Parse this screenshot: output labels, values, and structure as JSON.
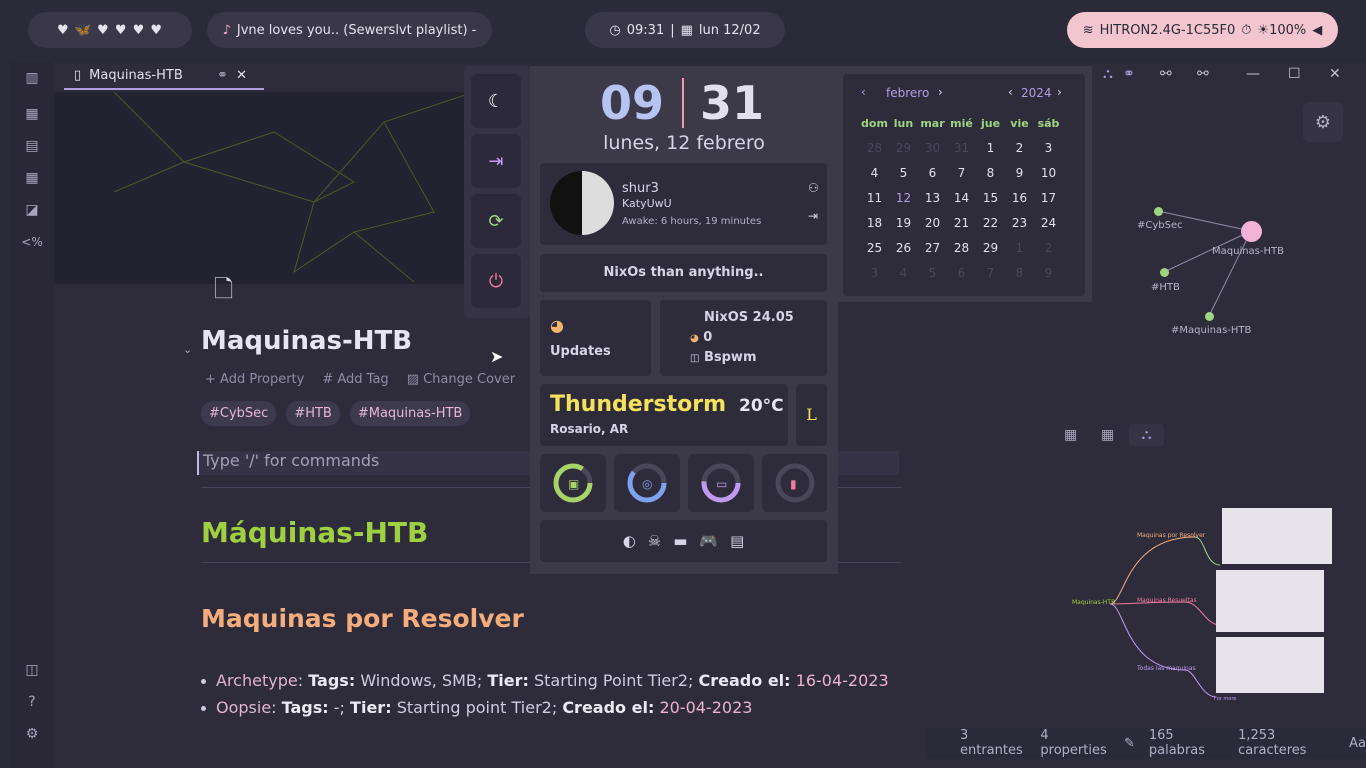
{
  "topbar": {
    "hearts": "♥ 🦋 ♥ ♥ ♥ ♥",
    "music_title": "Jvne loves you.. (Sewerslvt playlist) -",
    "time": "09:31",
    "date": "lun 12/02",
    "network": "HITRON2.4G-1C55F0",
    "brightness": "☀100%"
  },
  "tab": {
    "title": "Maquinas-HTB"
  },
  "page": {
    "title": "Maquinas-HTB",
    "add_property": "Add Property",
    "add_tag": "Add Tag",
    "change_cover": "Change Cover",
    "tags": [
      "#CybSec",
      "#HTB",
      "#Maquinas-HTB"
    ],
    "command_placeholder": "Type '/' for commands",
    "h1": "Máquinas-HTB",
    "h2": "Maquinas  por Resolver",
    "items": [
      {
        "link": "Archetype",
        "tags_label": "Tags:",
        "tags": "Windows, SMB;",
        "tier_label": "Tier:",
        "tier": "Starting Point Tier2;",
        "created_label": "Creado el:",
        "created": "16-04-2023"
      },
      {
        "link": "Oopsie",
        "tags_label": "Tags:",
        "tags": "-;",
        "tier_label": "Tier:",
        "tier": "Starting point Tier2;",
        "created_label": "Creado el:",
        "created": "20-04-2023"
      }
    ]
  },
  "dashboard": {
    "hour": "09",
    "minute": "31",
    "date_long": "lunes, 12 febrero",
    "user": "shur3",
    "host": "KatyUwU",
    "uptime": "Awake: 6 hours, 19 minutes",
    "motto": "NixOs than anything..",
    "updates_label": "Updates",
    "os": "NixOS 24.05",
    "updates_count": "0",
    "wm": "Bspwm",
    "weather": "Thunderstorm",
    "temp": "20°C",
    "city": "Rosario, AR",
    "weather_icon": "L"
  },
  "calendar": {
    "month": "febrero",
    "year": "2024",
    "weekdays": [
      "dom",
      "lun",
      "mar",
      "mié",
      "jue",
      "vie",
      "sáb"
    ],
    "days": [
      "28",
      "29",
      "30",
      "31",
      "1",
      "2",
      "3",
      "4",
      "5",
      "6",
      "7",
      "8",
      "9",
      "10",
      "11",
      "12",
      "13",
      "14",
      "15",
      "16",
      "17",
      "18",
      "19",
      "20",
      "21",
      "22",
      "23",
      "24",
      "25",
      "26",
      "27",
      "28",
      "29",
      "1",
      "2",
      "3",
      "4",
      "5",
      "6",
      "7",
      "8",
      "9"
    ]
  },
  "graph": {
    "nodes": [
      "#CybSec",
      "Maquinas-HTB",
      "#HTB",
      "#Maquinas-HTB"
    ]
  },
  "mindmap": {
    "root": "Maquinas-HTB",
    "branches": [
      "Maquinas por Resolver",
      "Maquinas Resueltas",
      "Todas las maquinas"
    ],
    "footer": "For more"
  },
  "status": {
    "incoming": "3 entrantes",
    "properties": "4 properties",
    "words": "165 palabras",
    "chars": "1,253 caracteres",
    "font": "Aa"
  },
  "colors": {
    "accent": "#b19ee0",
    "green": "#9fd03f",
    "orange": "#f6ad7d",
    "pink": "#f3c6cf"
  }
}
